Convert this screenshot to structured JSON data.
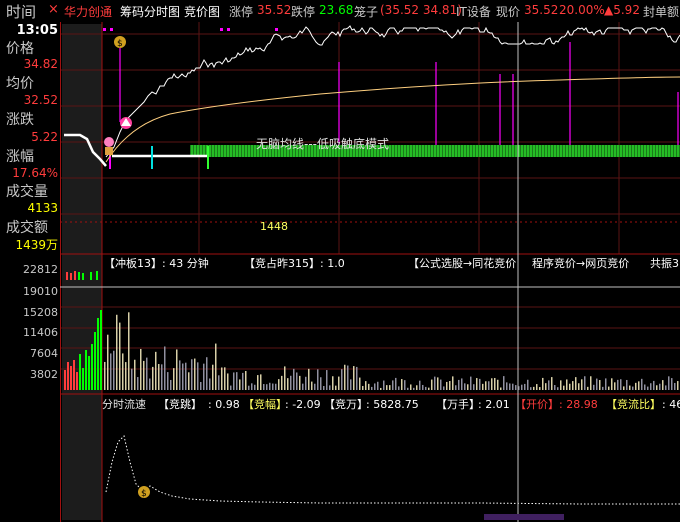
{
  "topbar": {
    "time_label": "时间",
    "close": "×",
    "stock_name": "华力创通",
    "tab_chip": "筹码分时图",
    "tab_auction": "竞价图",
    "limit_up_label": "涨停",
    "limit_up_value": "35.52",
    "limit_down_label": "跌停",
    "limit_down_value": "23.68",
    "cage_label": "笼子",
    "cage_value": "(35.52 34.81)",
    "sector": "IT设备",
    "price_label": "现价",
    "price_value": "35.52",
    "change_pct": "20.00%",
    "change_arrow": "▲5.92",
    "seal_label": "封单额"
  },
  "sidebar": {
    "time_value": "13:05",
    "price_label": "价格",
    "price_value": "34.82",
    "avg_label": "均价",
    "avg_value": "32.52",
    "change_label": "涨跌",
    "change_value": "5.22",
    "pct_label": "涨幅",
    "pct_value": "17.64%",
    "vol_label": "成交量",
    "vol_value": "4133",
    "amount_label": "成交额",
    "amount_value": "1439万",
    "vol_axis": [
      "22812",
      "19010",
      "15208",
      "11406",
      "7604",
      "3802"
    ]
  },
  "main_chart": {
    "annotation": "无脑均线---低吸触底模式",
    "mid_value": "1448",
    "colors": {
      "price": "#ffffff",
      "avg": "#ffd080",
      "up": "#ff3c3c",
      "down": "#00ff00",
      "magenta": "#ff00ff"
    }
  },
  "volume_header": {
    "board": "【冲板13】: 43 分钟",
    "rank": "【竞占昨315】: 1.0",
    "formula": "【公式选股→同花竞价",
    "program": "程序竞价→网页竞价",
    "amplitude": "共振3"
  },
  "flow_header": {
    "title": "分时流速",
    "jump_label": "【竞跳】",
    "jump_value": ": 0.98",
    "amp_label": "【竞幅】",
    "amp_value": ": -2.09",
    "wan_label": "【竞万】",
    "wan_value": ": 5828.75",
    "hand_label": "【万手】",
    "hand_value": ": 2.01",
    "open_label": "【开价】",
    "open_value": ": 28.98",
    "ratio_label": "【竞流比】",
    "ratio_value": ": 46"
  }
}
